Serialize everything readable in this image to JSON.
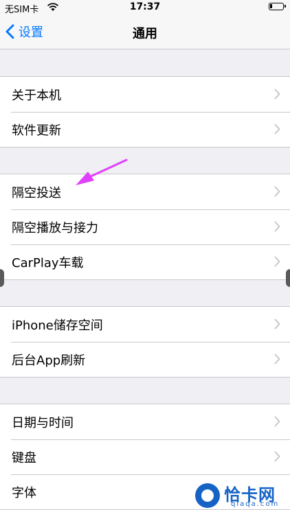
{
  "status_bar": {
    "carrier": "无SIM卡",
    "time": "17:37"
  },
  "nav": {
    "back_label": "设置",
    "title": "通用"
  },
  "groups": [
    {
      "items": [
        {
          "label": "关于本机"
        },
        {
          "label": "软件更新"
        }
      ]
    },
    {
      "items": [
        {
          "label": "隔空投送"
        },
        {
          "label": "隔空播放与接力"
        },
        {
          "label": "CarPlay车载"
        }
      ]
    },
    {
      "items": [
        {
          "label": "iPhone储存空间"
        },
        {
          "label": "后台App刷新"
        }
      ]
    },
    {
      "items": [
        {
          "label": "日期与时间"
        },
        {
          "label": "键盘"
        },
        {
          "label": "字体"
        }
      ]
    }
  ],
  "watermark": {
    "text": "恰卡网",
    "domain": "qiaqa.com"
  },
  "colors": {
    "accent": "#007aff",
    "annotation": "#e040fb",
    "background": "#efeff4"
  }
}
